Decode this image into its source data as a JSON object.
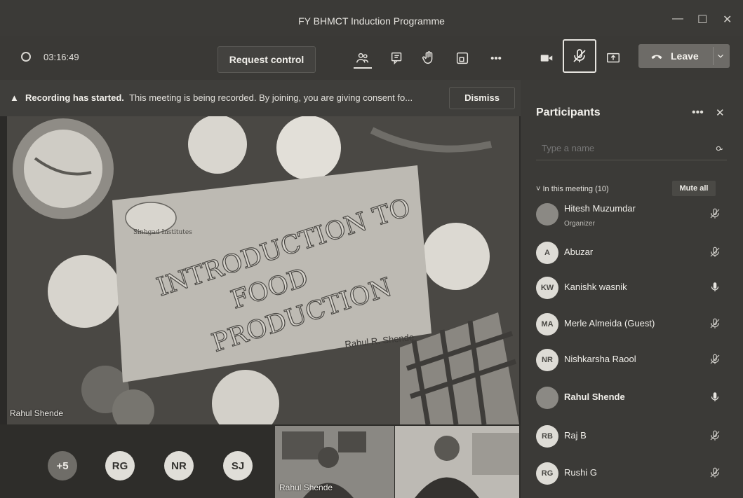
{
  "window": {
    "title": "FY BHMCT Induction Programme",
    "minimize": "—",
    "maximize": "☐",
    "close": "✕"
  },
  "toolbar": {
    "timer": "03:16:49",
    "request_control": "Request control",
    "leave_label": "Leave",
    "more": "•••",
    "icons": [
      "people-icon",
      "chat-icon",
      "raise-hand-icon",
      "rooms-icon",
      "more-icon",
      "camera-icon",
      "mic-off-icon",
      "share-icon",
      "phone-icon",
      "chevron-down-icon"
    ]
  },
  "banner": {
    "bold": "Recording has started.",
    "text": "This meeting is being recorded. By joining, you are giving consent fo...",
    "dismiss": "Dismiss"
  },
  "stage": {
    "slide": {
      "line1": "INTRODUCTION TO",
      "line2": "FOOD",
      "line3": "PRODUCTION",
      "logo_text": "Sinhgad Institutes",
      "author": "Rahul R. Shende"
    },
    "presenter_label": "Rahul Shende"
  },
  "bottom": {
    "overflow": "+5",
    "avatars": [
      "RG",
      "NR",
      "SJ"
    ],
    "video_label": "Rahul Shende"
  },
  "panel": {
    "title": "Participants",
    "more": "•••",
    "close": "✕",
    "search_placeholder": "Type a name",
    "section": "In this meeting (10)",
    "mute_all": "Mute all",
    "participants": [
      {
        "initials": "",
        "name": "Hitesh Muzumdar",
        "role": "Organizer",
        "mic": "muted"
      },
      {
        "initials": "A",
        "name": "Abuzar",
        "role": "",
        "mic": "muted"
      },
      {
        "initials": "KW",
        "name": "Kanishk wasnik",
        "role": "",
        "mic": "on"
      },
      {
        "initials": "MA",
        "name": "Merle Almeida (Guest)",
        "role": "",
        "mic": "muted"
      },
      {
        "initials": "NR",
        "name": "Nishkarsha Raool",
        "role": "",
        "mic": "muted"
      },
      {
        "initials": "",
        "name": "Rahul Shende",
        "role": "",
        "mic": "on"
      },
      {
        "initials": "RB",
        "name": "Raj B",
        "role": "",
        "mic": "muted"
      },
      {
        "initials": "RG",
        "name": "Rushi G",
        "role": "",
        "mic": "muted"
      }
    ]
  },
  "colors": {
    "background": "#2b2a28",
    "panel": "#3b3a37",
    "leave_button": "#6d6b67"
  }
}
